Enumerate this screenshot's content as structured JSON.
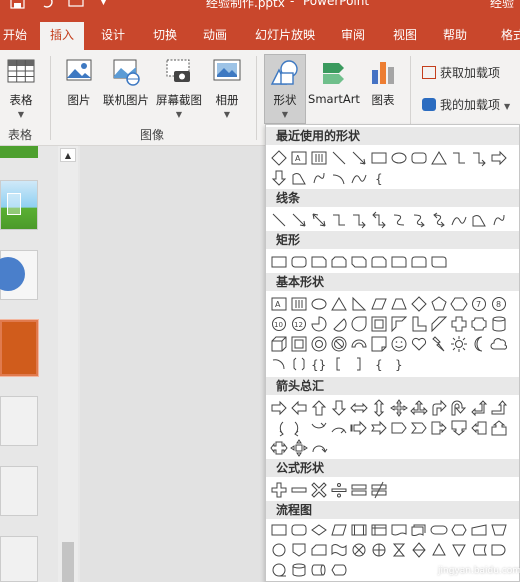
{
  "title_bar": {
    "filename": "经验制作.pptx",
    "app": "PowerPoint",
    "separator": "-",
    "account": "经验"
  },
  "tabs": [
    {
      "label": "开始"
    },
    {
      "label": "插入"
    },
    {
      "label": "设计"
    },
    {
      "label": "切换"
    },
    {
      "label": "动画"
    },
    {
      "label": "幻灯片放映"
    },
    {
      "label": "审阅"
    },
    {
      "label": "视图"
    },
    {
      "label": "帮助"
    },
    {
      "label": "格式"
    }
  ],
  "active_tab": "插入",
  "ribbon": {
    "table": "表格",
    "picture": "图片",
    "online_picture": "联机图片",
    "screenshot": "屏幕截图",
    "album": "相册",
    "shapes": "形状",
    "smartart": "SmartArt",
    "chart": "图表",
    "get_addins": "获取加载项",
    "my_addins": "我的加载项",
    "group_table": "表格",
    "group_images": "图像"
  },
  "shapes_menu": {
    "sections": [
      "最近使用的形状",
      "线条",
      "矩形",
      "基本形状",
      "箭头总汇",
      "公式形状",
      "流程图"
    ]
  },
  "colors": {
    "accent": "#c9472c",
    "ribbon_bg": "#f3f2f1",
    "slide_orange": "#d05c1c",
    "slide_green": "#4da02e"
  },
  "watermark": "jingyan.baidu.com"
}
